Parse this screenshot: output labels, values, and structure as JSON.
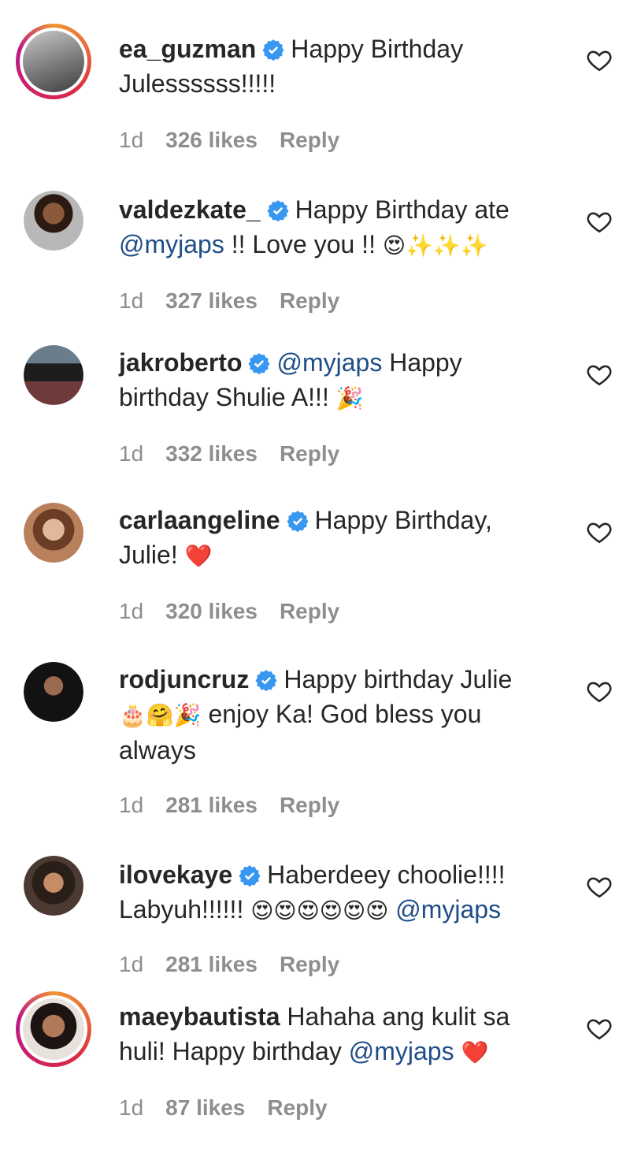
{
  "comments": [
    {
      "user": "ea_guzman",
      "verified": true,
      "line1": "Happy Birthday",
      "line2": "Julessssss!!!!!",
      "time": "1d",
      "likes": "326 likes",
      "reply": "Reply"
    },
    {
      "user": "valdezkate_",
      "verified": true,
      "line1": "Happy Birthday ate",
      "mention": "@myjaps",
      "line2": " !! Love you !! ",
      "emoji": "😍✨✨✨",
      "time": "1d",
      "likes": "327 likes",
      "reply": "Reply"
    },
    {
      "user": "jakroberto",
      "verified": true,
      "mention": "@myjaps",
      "line1": " Happy",
      "line2": "birthday Shulie A!!! ",
      "emoji": "🎉",
      "time": "1d",
      "likes": "332 likes",
      "reply": "Reply"
    },
    {
      "user": "carlaangeline",
      "verified": true,
      "line1": "Happy Birthday,",
      "line2": "Julie! ",
      "emoji": "❤️",
      "time": "1d",
      "likes": "320 likes",
      "reply": "Reply"
    },
    {
      "user": "rodjuncruz",
      "verified": true,
      "line1": "Happy birthday Julie",
      "emoji": "🎂🤗🎉",
      "line2": " enjoy Ka! God bless you",
      "line3": "always",
      "time": "1d",
      "likes": "281 likes",
      "reply": "Reply"
    },
    {
      "user": "ilovekaye",
      "verified": true,
      "line1": "Haberdeey choolie!!!!",
      "line2": "Labyuh!!!!!! ",
      "emoji": "😍😍😍😍😍😍",
      "mention": " @myjaps",
      "time": "1d",
      "likes": "281 likes",
      "reply": "Reply"
    },
    {
      "user": "maeybautista",
      "verified": false,
      "line1": " Hahaha ang kulit sa",
      "line2": "huli! Happy birthday ",
      "mention": "@myjaps",
      "emoji": " ❤️",
      "time": "1d",
      "likes": "87 likes",
      "reply": "Reply"
    }
  ],
  "colors": {
    "mention": "#1f4e87",
    "verified": "#3897f0",
    "meta": "#8e8e8e",
    "heart_red": "#e0245e"
  },
  "icons": {
    "verified": "verified-badge-icon",
    "like": "heart-outline-icon"
  }
}
